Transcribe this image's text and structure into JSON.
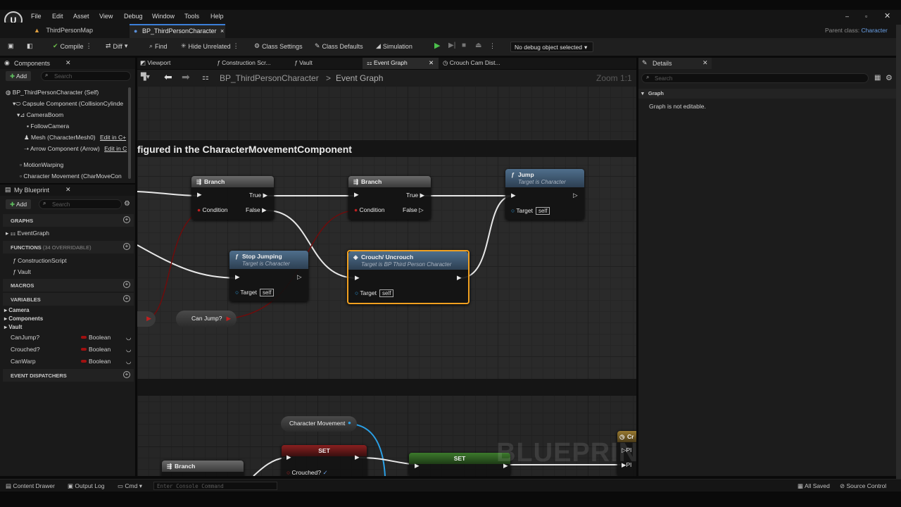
{
  "menu": [
    "File",
    "Edit",
    "Asset",
    "View",
    "Debug",
    "Window",
    "Tools",
    "Help"
  ],
  "doc_tabs": [
    {
      "label": "ThirdPersonMap"
    },
    {
      "label": "BP_ThirdPersonCharacter",
      "close": "×"
    }
  ],
  "parent_class": {
    "label": "Parent class:",
    "value": "Character"
  },
  "toolbar": {
    "compile": "Compile",
    "diff": "Diff",
    "find": "Find",
    "hide_unrelated": "Hide Unrelated",
    "class_settings": "Class Settings",
    "class_defaults": "Class Defaults",
    "simulation": "Simulation",
    "debug_object": "No debug object selected"
  },
  "components": {
    "title": "Components",
    "add": "Add",
    "search_placeholder": "Search",
    "tree": [
      {
        "label": "BP_ThirdPersonCharacter (Self)"
      },
      {
        "label": "Capsule Component (CollisionCylinde"
      },
      {
        "label": "CameraBoom"
      },
      {
        "label": "FollowCamera"
      },
      {
        "label": "Mesh (CharacterMesh0)",
        "link": "Edit in C+"
      },
      {
        "label": "Arrow Component (Arrow)",
        "link": "Edit in C"
      },
      {
        "label": "MotionWarping"
      },
      {
        "label": "Character Movement (CharMoveCon"
      }
    ]
  },
  "my_blueprint": {
    "title": "My Blueprint",
    "add": "Add",
    "search_placeholder": "Search",
    "graphs": "GRAPHS",
    "event_graph": "EventGraph",
    "functions": "FUNCTIONS",
    "functions_count": "(34 OVERRIDABLE)",
    "construction_script": "ConstructionScript",
    "vault": "Vault",
    "macros": "MACROS",
    "variables": "VARIABLES",
    "categories": [
      "Camera",
      "Components",
      "Vault"
    ],
    "vars": [
      {
        "name": "CanJump?",
        "type": "Boolean"
      },
      {
        "name": "Crouched?",
        "type": "Boolean"
      },
      {
        "name": "CanWarp",
        "type": "Boolean"
      }
    ],
    "event_dispatchers": "EVENT DISPATCHERS"
  },
  "editor_tabs": [
    "Viewport",
    "Construction Scr...",
    "Vault",
    "Event Graph",
    "Crouch Cam Dist..."
  ],
  "breadcrumb": {
    "bp": "BP_ThirdPersonCharacter",
    "sep": ">",
    "graph": "Event Graph",
    "zoom": "Zoom 1:1"
  },
  "comment_text": "figured in the CharacterMovementComponent",
  "watermark": "BLUEPRINT",
  "nodes": {
    "branch": "Branch",
    "true": "True",
    "false": "False",
    "condition": "Condition",
    "jump": "Jump",
    "jump_sub": "Target is Character",
    "stop": "Stop Jumping",
    "stop_sub": "Target is Character",
    "crouch": "Crouch/ Uncrouch",
    "crouch_sub": "Target is BP Third Person Character",
    "target": "Target",
    "self": "self",
    "canjump": "Can Jump?",
    "charmove": "Character Movement",
    "set": "SET",
    "crouched": "Crouched?",
    "pl": "Pl",
    "c": "Cr"
  },
  "details": {
    "title": "Details",
    "search_placeholder": "Search",
    "section": "Graph",
    "message": "Graph is not editable."
  },
  "bottom": {
    "content_drawer": "Content Drawer",
    "output_log": "Output Log",
    "cmd": "Cmd",
    "console_placeholder": "Enter Console Command",
    "all_saved": "All Saved",
    "source_control": "Source Control"
  }
}
